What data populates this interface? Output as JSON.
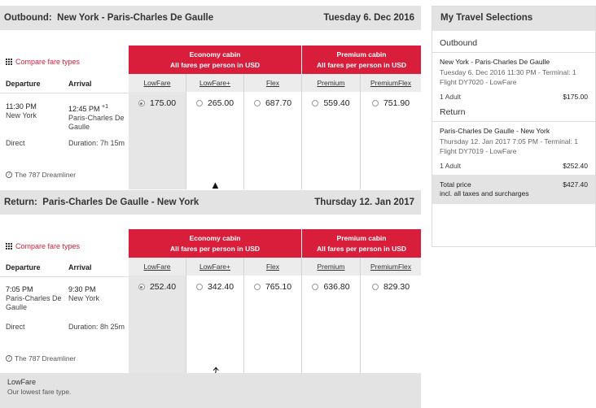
{
  "outbound": {
    "label": "Outbound:",
    "route": "New York - Paris-Charles De Gaulle",
    "date": "Tuesday 6. Dec 2016",
    "compare_label": "Compare fare types",
    "col_departure": "Departure",
    "col_arrival": "Arrival",
    "dep_time": "11:30 PM",
    "dep_place": "New York",
    "arr_time": "12:45 PM",
    "arr_plus": "+1",
    "arr_place": "Paris-Charles De Gaulle",
    "stops": "Direct",
    "duration": "Duration: 7h 15m",
    "aircraft": "The 787 Dreamliner"
  },
  "return": {
    "label": "Return:",
    "route": "Paris-Charles De Gaulle - New York",
    "date": "Thursday 12. Jan 2017",
    "compare_label": "Compare fare types",
    "col_departure": "Departure",
    "col_arrival": "Arrival",
    "dep_time": "7:05 PM",
    "dep_place": "Paris-Charles De Gaulle",
    "arr_time": "9:30 PM",
    "arr_place": "New York",
    "stops": "Direct",
    "duration": "Duration: 8h 25m",
    "aircraft": "The 787 Dreamliner"
  },
  "cabins": {
    "economy_name": "Economy cabin",
    "economy_note": "All fares per person in USD",
    "premium_name": "Premium cabin",
    "premium_note": "All fares per person in USD"
  },
  "fare_types": [
    "LowFare",
    "LowFare+",
    "Flex",
    "Premium",
    "PremiumFlex"
  ],
  "outbound_prices": [
    "175.00",
    "265.00",
    "687.70",
    "559.40",
    "751.90"
  ],
  "return_prices": [
    "252.40",
    "342.40",
    "765.10",
    "636.80",
    "829.30"
  ],
  "selected_fare": "LowFare",
  "legend": {
    "title": "LowFare",
    "desc": "Our lowest fare type."
  },
  "selections": {
    "title": "My Travel Selections",
    "outbound_label": "Outbound",
    "outbound_route": "New York - Paris-Charles De Gaulle",
    "outbound_detail": "Tuesday 6. Dec 2016 11:30 PM - Terminal: 1",
    "outbound_flight": "Flight DY7020 - LowFare",
    "outbound_pax": "1 Adult",
    "outbound_price": "$175.00",
    "return_label": "Return",
    "return_route": "Paris-Charles De Gaulle - New York",
    "return_detail": "Thursday 12. Jan 2017 7:05 PM - Terminal: 1",
    "return_flight": "Flight DY7019 - LowFare",
    "return_pax": "1 Adult",
    "return_price": "$252.40",
    "total_label": "Total price",
    "total_note": "incl. all taxes and surcharges",
    "total_value": "$427.40"
  },
  "colors": {
    "accent": "#d81e3a",
    "header_bg": "#e3e3e3",
    "selected_bg": "#e6e6e6"
  }
}
